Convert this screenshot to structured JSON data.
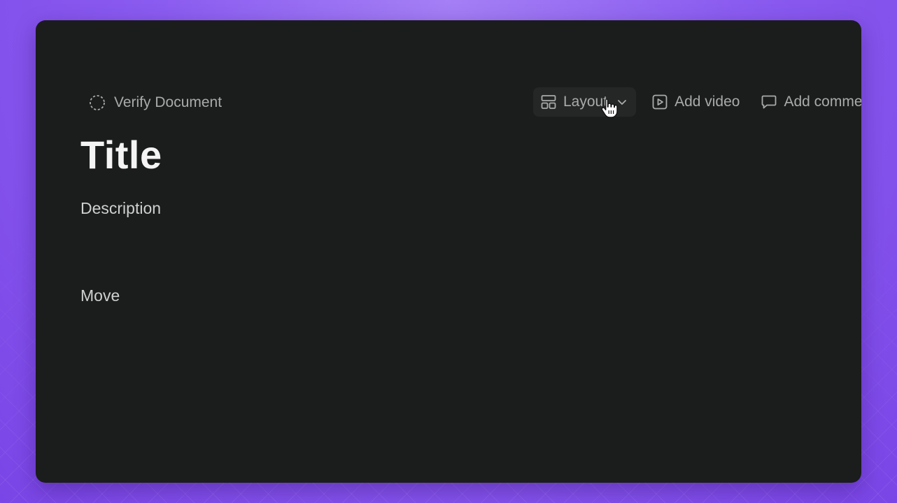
{
  "toolbar": {
    "verify_label": "Verify Document",
    "layout_label": "Layout",
    "add_video_label": "Add video",
    "add_comment_label": "Add comment"
  },
  "document": {
    "title": "Title",
    "description": "Description",
    "move_label": "Move"
  },
  "icons": {
    "verify": "dashed-circle-icon",
    "layout": "layout-icon",
    "chevron": "chevron-down-icon",
    "video": "video-icon",
    "comment": "comment-icon",
    "cursor": "hand-pointer-icon"
  },
  "colors": {
    "background": "#8b5cf0",
    "window": "#1b1c1c",
    "layout_button": "#252626",
    "toolbar_text": "#a9abab",
    "title_text": "#f4f4f4",
    "body_text": "#cfd0d0"
  }
}
